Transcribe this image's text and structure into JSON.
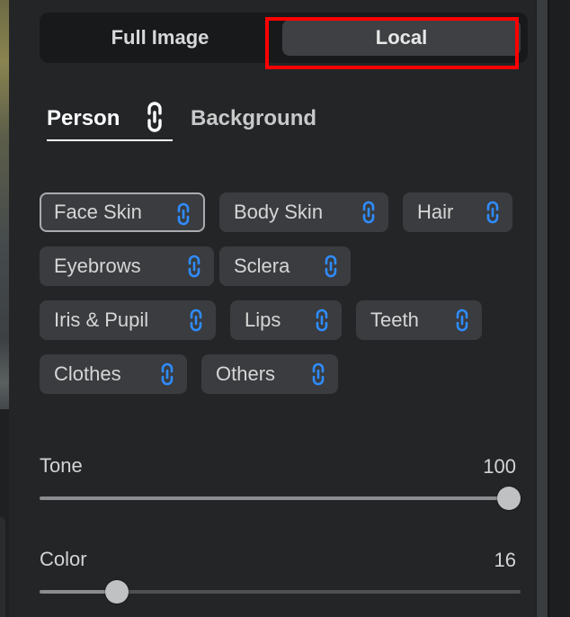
{
  "mode_toggle": {
    "full_image_label": "Full Image",
    "local_label": "Local",
    "selected": "Local"
  },
  "target_tabs": {
    "person_label": "Person",
    "background_label": "Background",
    "selected": "Person"
  },
  "regions": [
    {
      "label": "Face Skin",
      "selected": true
    },
    {
      "label": "Body Skin",
      "selected": false
    },
    {
      "label": "Hair",
      "selected": false
    },
    {
      "label": "Eyebrows",
      "selected": false
    },
    {
      "label": "Sclera",
      "selected": false
    },
    {
      "label": "Iris & Pupil",
      "selected": false
    },
    {
      "label": "Lips",
      "selected": false
    },
    {
      "label": "Teeth",
      "selected": false
    },
    {
      "label": "Clothes",
      "selected": false
    },
    {
      "label": "Others",
      "selected": false
    }
  ],
  "sliders": {
    "tone": {
      "label": "Tone",
      "value": "100",
      "level": 1.0
    },
    "color": {
      "label": "Color",
      "value": "16",
      "level": 0.16
    }
  },
  "colors": {
    "link_icon": "#2f8cff",
    "highlight": "#ff0000",
    "panel_bg": "#232527",
    "chip_bg": "#3a3c3f"
  },
  "icons": {
    "region_link": "link-icon",
    "person_link": "link-icon"
  }
}
